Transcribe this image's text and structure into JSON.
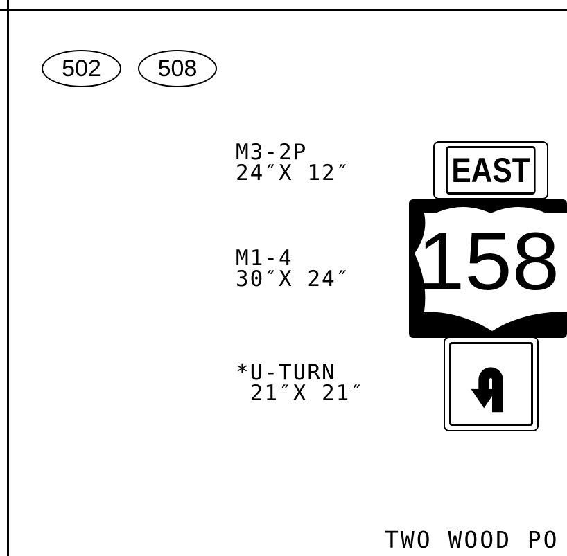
{
  "callouts": [
    "502",
    "508"
  ],
  "signs": [
    {
      "code": "M3-2P",
      "size": "24″X 12″"
    },
    {
      "code": "M1-4",
      "size": "30″X 24″"
    },
    {
      "code": "*U-TURN",
      "size": " 21″X 21″"
    }
  ],
  "east_sign": {
    "text": "EAST"
  },
  "route_shield": {
    "number": "158"
  },
  "uturn_sign": {
    "icon": "u-turn-left-arrow-icon"
  },
  "footer": {
    "text": "TWO WOOD PO"
  }
}
